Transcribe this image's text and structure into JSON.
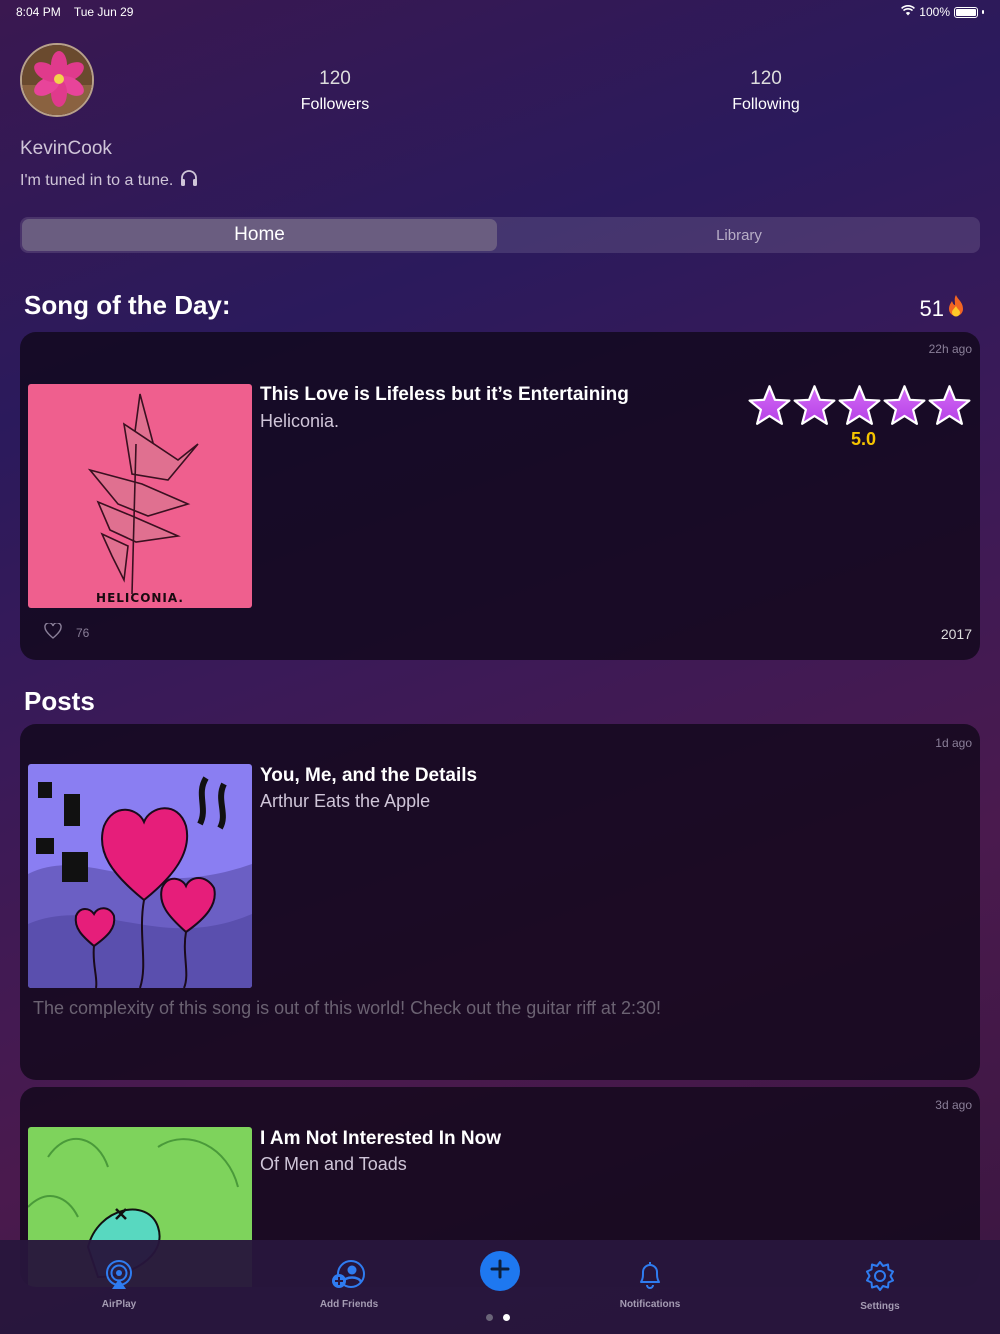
{
  "status_bar": {
    "time": "8:04 PM",
    "date": "Tue Jun 29",
    "battery": "100%"
  },
  "profile": {
    "username": "KevinCook",
    "bio": "I'm tuned in to a tune.",
    "followers_count": "120",
    "followers_label": "Followers",
    "following_count": "120",
    "following_label": "Following"
  },
  "segments": {
    "home": "Home",
    "library": "Library"
  },
  "song_of_day": {
    "heading": "Song of the Day:",
    "streak": "51",
    "time_ago": "22h ago",
    "title": "This Love is Lifeless but it’s Entertaining",
    "artist": "Heliconia.",
    "art_text": "HELICONIA.",
    "rating": "5.0",
    "stars": 5,
    "likes": "76",
    "year": "2017"
  },
  "posts": {
    "heading": "Posts",
    "items": [
      {
        "time_ago": "1d ago",
        "title": "You, Me, and the Details",
        "artist": "Arthur Eats the Apple",
        "caption": "The complexity of this song is out of this world! Check out the guitar riff at 2:30!"
      },
      {
        "time_ago": "3d ago",
        "title": "I Am Not Interested In Now",
        "artist": "Of Men and Toads"
      }
    ]
  },
  "tabbar": {
    "airplay": "AirPlay",
    "add_friends": "Add Friends",
    "notifications": "Notifications",
    "settings": "Settings"
  },
  "colors": {
    "accent": "#1e78f0",
    "star": "#b540e6",
    "rating": "#f5c400",
    "art_pink": "#ef5f8e",
    "art_purple": "#8a7ef2",
    "art_green": "#7ed35c"
  }
}
